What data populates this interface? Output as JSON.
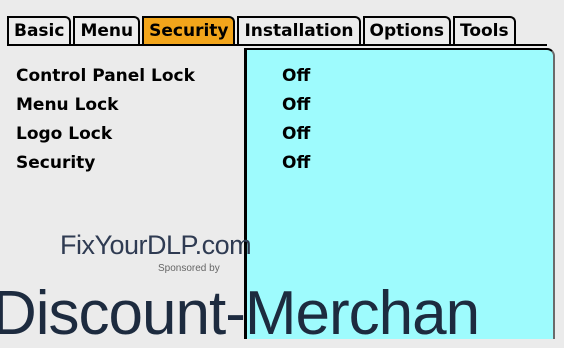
{
  "tabs": [
    {
      "label": "Basic",
      "active": false
    },
    {
      "label": "Menu",
      "active": false
    },
    {
      "label": "Security",
      "active": true
    },
    {
      "label": "Installation",
      "active": false
    },
    {
      "label": "Options",
      "active": false
    },
    {
      "label": "Tools",
      "active": false
    }
  ],
  "settings": [
    {
      "label": "Control Panel Lock",
      "value": "Off"
    },
    {
      "label": "Menu Lock",
      "value": "Off"
    },
    {
      "label": "Logo Lock",
      "value": "Off"
    },
    {
      "label": "Security",
      "value": "Off"
    }
  ],
  "watermark": {
    "site": "FixYourDLP.com",
    "sponsor": "Sponsored by",
    "banner": "Discount-Merchan"
  },
  "colors": {
    "active_tab": "#f2a51b",
    "panel_background": "#9efbfd",
    "menu_background": "#ebebeb"
  }
}
